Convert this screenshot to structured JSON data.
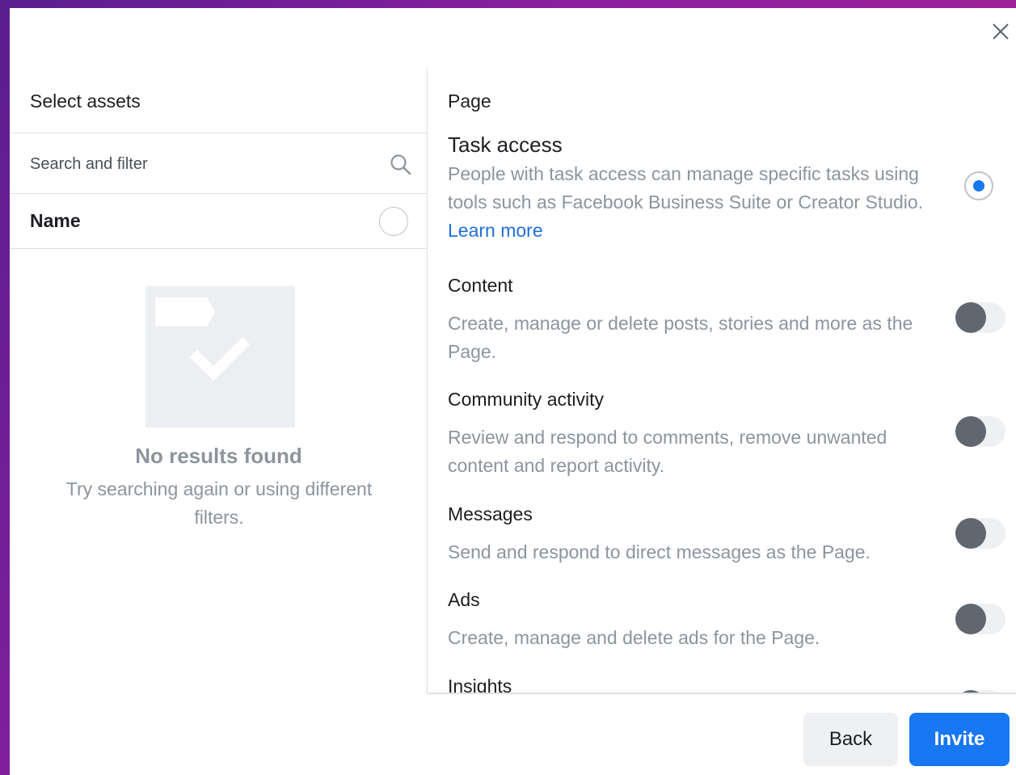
{
  "left_panel": {
    "title": "Select assets",
    "search_placeholder": "Search and filter",
    "name_header": "Name",
    "empty_title": "No results found",
    "empty_desc": "Try searching again or using different filters."
  },
  "right_panel": {
    "title": "Page",
    "task_access": {
      "title": "Task access",
      "desc": "People with task access can manage specific tasks using tools such as Facebook Business Suite or Creator Studio. ",
      "link": "Learn more",
      "selected": true
    },
    "permissions": [
      {
        "title": "Content",
        "desc": "Create, manage or delete posts, stories and more as the Page.",
        "enabled": false
      },
      {
        "title": "Community activity",
        "desc": "Review and respond to comments, remove unwanted content and report activity.",
        "enabled": false
      },
      {
        "title": "Messages",
        "desc": "Send and respond to direct messages as the Page.",
        "enabled": false
      },
      {
        "title": "Ads",
        "desc": "Create, manage and delete ads for the Page.",
        "enabled": false
      },
      {
        "title": "Insights",
        "desc": "",
        "enabled": false
      }
    ]
  },
  "footer": {
    "back_label": "Back",
    "invite_label": "Invite"
  },
  "colors": {
    "accent": "#1877f2",
    "toggle_off_knob": "#606770",
    "muted_text": "#8d949e"
  }
}
